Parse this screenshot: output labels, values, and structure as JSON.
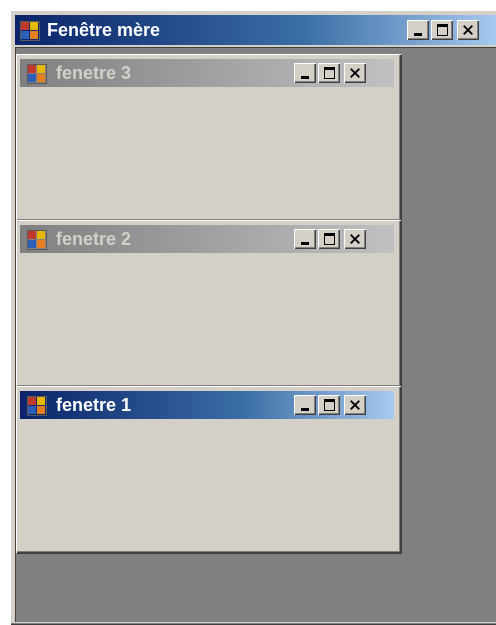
{
  "parent_window": {
    "title": "Fenêtre mère",
    "icon": "app-window-icon",
    "controls": [
      "minimize",
      "maximize",
      "close"
    ]
  },
  "child_windows": [
    {
      "title": "fenetre 3",
      "state": "inactive",
      "icon": "app-window-icon"
    },
    {
      "title": "fenetre 2",
      "state": "inactive",
      "icon": "app-window-icon"
    },
    {
      "title": "fenetre 1",
      "state": "active",
      "icon": "app-window-icon"
    }
  ],
  "colors": {
    "active_title": "#0a246a",
    "inactive_title": "#808080",
    "window_face": "#d4d0c8",
    "mdi_background": "#808080"
  }
}
